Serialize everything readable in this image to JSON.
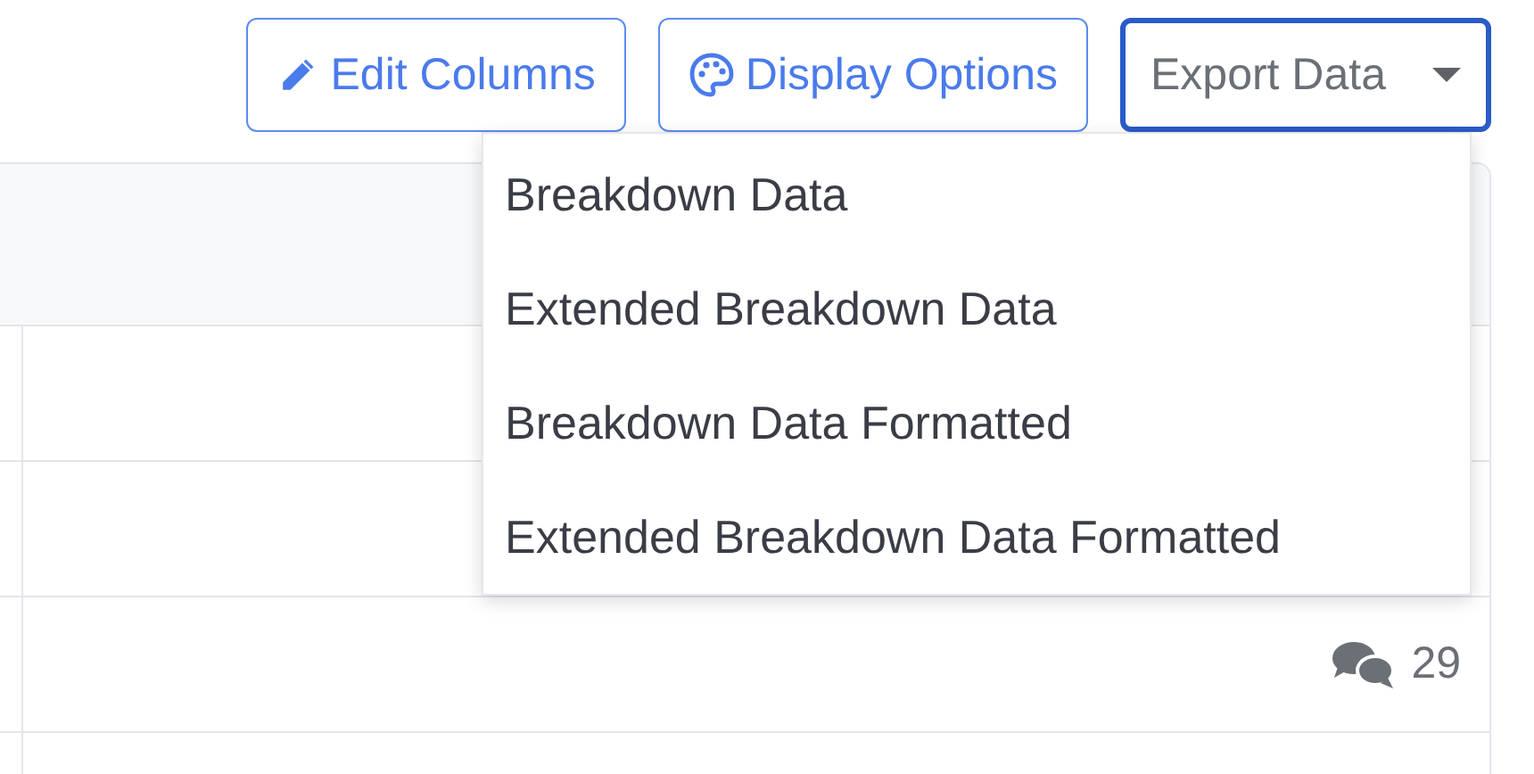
{
  "toolbar": {
    "buttons": [
      {
        "kind": "pencil",
        "label": "Edit Columns"
      },
      {
        "kind": "palette",
        "label": "Display Options"
      },
      {
        "kind": "dropdown",
        "label": "Export Data",
        "expanded": true
      }
    ]
  },
  "export_menu": {
    "items": [
      "Breakdown Data",
      "Extended Breakdown Data",
      "Breakdown Data Formatted",
      "Extended Breakdown Data Formatted"
    ]
  },
  "table": {
    "rows": [
      {
        "kind": "blank"
      },
      {
        "kind": "blank"
      },
      {
        "kind": "comments",
        "count": "29"
      },
      {
        "kind": "blank"
      }
    ]
  }
}
